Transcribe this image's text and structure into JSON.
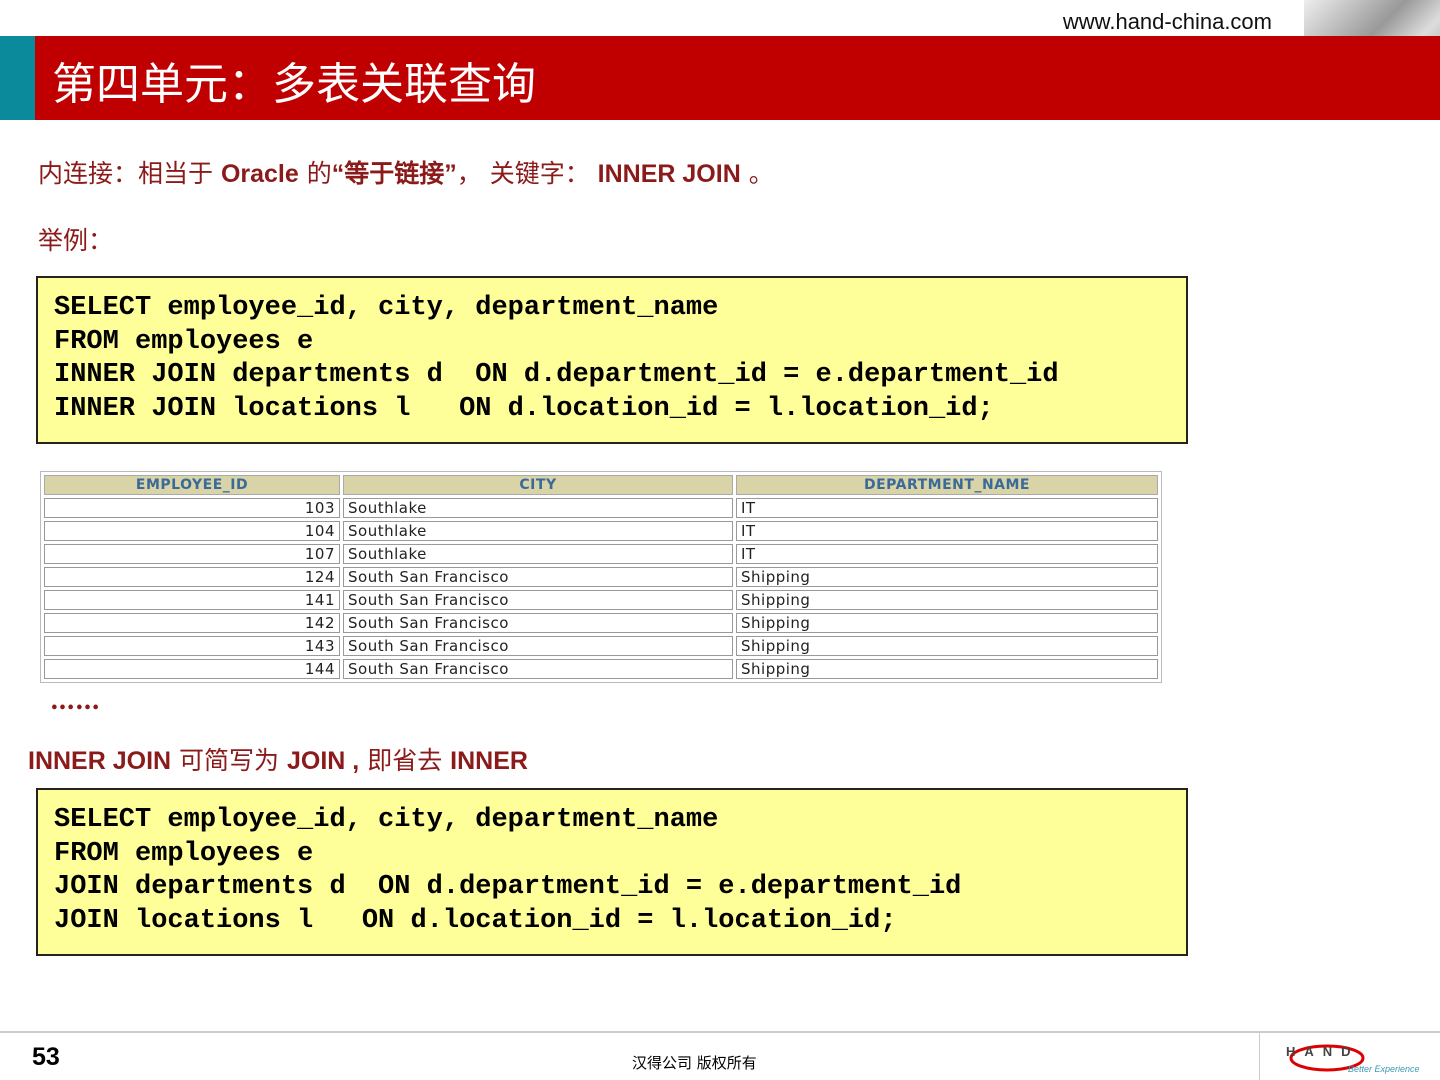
{
  "header": {
    "url": "www.hand-china.com",
    "title": "第四单元：多表关联查询"
  },
  "intro": {
    "a": "内连接：相当于 ",
    "b": "Oracle",
    "c": " 的",
    "d": "“等于链接”",
    "e": "，  关键字： ",
    "f": "INNER JOIN",
    "g": " 。"
  },
  "example_label": "举例：",
  "code1": "SELECT employee_id, city, department_name\nFROM employees e\nINNER JOIN departments d  ON d.department_id = e.department_id\nINNER JOIN locations l   ON d.location_id = l.location_id;",
  "table": {
    "headers": [
      "EMPLOYEE_ID",
      "CITY",
      "DEPARTMENT_NAME"
    ],
    "rows": [
      [
        "103",
        "Southlake",
        "IT"
      ],
      [
        "104",
        "Southlake",
        "IT"
      ],
      [
        "107",
        "Southlake",
        "IT"
      ],
      [
        "124",
        "South San Francisco",
        "Shipping"
      ],
      [
        "141",
        "South San Francisco",
        "Shipping"
      ],
      [
        "142",
        "South San Francisco",
        "Shipping"
      ],
      [
        "143",
        "South San Francisco",
        "Shipping"
      ],
      [
        "144",
        "South San Francisco",
        "Shipping"
      ]
    ]
  },
  "ellipsis": "……",
  "note": {
    "a": "INNER JOIN",
    "b": "  可简写为 ",
    "c": "JOIN ,",
    "d": " 即省去 ",
    "e": "INNER"
  },
  "code2": "SELECT employee_id, city, department_name\nFROM employees e\nJOIN departments d  ON d.department_id = e.department_id\nJOIN locations l   ON d.location_id = l.location_id;",
  "footer": {
    "page": "53",
    "copyright": "汉得公司  版权所有",
    "logo": "HAND",
    "tagline": "Better Experience"
  }
}
